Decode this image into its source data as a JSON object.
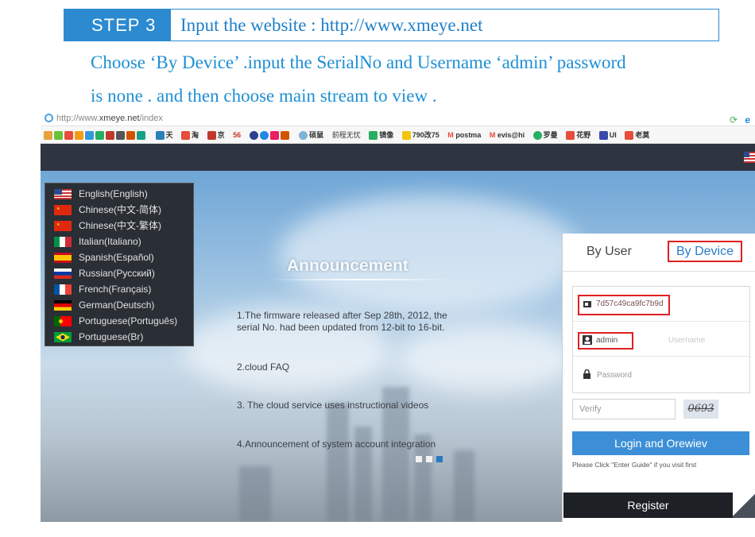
{
  "step": {
    "label": "STEP 3",
    "title": "Input the website : http://www.xmeye.net"
  },
  "instructions": {
    "line1": "Choose ‘By Device’ .input the SerialNo  and Username ‘admin’ password",
    "line2": "is none . and then choose main stream to view ."
  },
  "browser": {
    "url_scheme": "http://www.",
    "url_host": "xmeye.net",
    "url_path": "/index",
    "bookmarks": [
      "天",
      "淘",
      "京",
      "56",
      "硕鼠",
      "前程无忧",
      "镜像",
      "790改75",
      "postma",
      "evis@hi",
      "罗曼",
      "花野",
      "UI",
      "老莫"
    ]
  },
  "languages": [
    {
      "label": "English(English)",
      "flag": "us"
    },
    {
      "label": "Chinese(中文-简体)",
      "flag": "cn"
    },
    {
      "label": "Chinese(中文-繁体)",
      "flag": "cn"
    },
    {
      "label": "Italian(Italiano)",
      "flag": "it"
    },
    {
      "label": "Spanish(Español)",
      "flag": "es"
    },
    {
      "label": "Russian(Русский)",
      "flag": "ru"
    },
    {
      "label": "French(Français)",
      "flag": "fr"
    },
    {
      "label": "German(Deutsch)",
      "flag": "de"
    },
    {
      "label": "Portuguese(Português)",
      "flag": "pt"
    },
    {
      "label": "Portuguese(Br)",
      "flag": "br"
    }
  ],
  "announcement": {
    "title": "Announcement",
    "items": [
      "1.The firmware released after Sep 28th, 2012, the",
      "serial No. had been updated from 12-bit to 16-bit.",
      "2.cloud FAQ",
      "3. The cloud service uses instructional videos",
      "4.Announcement of system account integration"
    ]
  },
  "login": {
    "tab_user": "By User",
    "tab_device": "By Device",
    "serial_value": "7d57c49ca9fc7b9d",
    "username_value": "admin",
    "username_placeholder": "Username",
    "password_placeholder": "Password",
    "verify_placeholder": "Verify",
    "captcha_text": "0693",
    "login_button": "Login and Orewiev",
    "guide_text": "Please Click \"Enter Guide\" if you visit first",
    "register_button": "Register"
  },
  "colors": {
    "accent": "#2b8ad0",
    "highlight": "#e02020",
    "nav_dark": "#2e3440"
  }
}
